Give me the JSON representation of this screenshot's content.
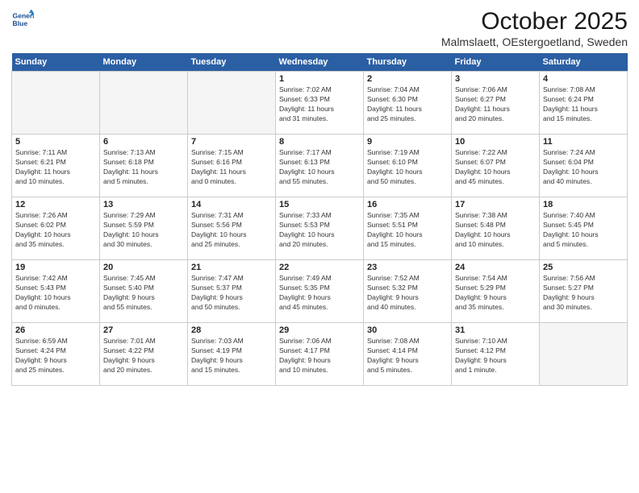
{
  "header": {
    "logo_line1": "General",
    "logo_line2": "Blue",
    "month": "October 2025",
    "location": "Malmslaett, OEstergoetland, Sweden"
  },
  "weekdays": [
    "Sunday",
    "Monday",
    "Tuesday",
    "Wednesday",
    "Thursday",
    "Friday",
    "Saturday"
  ],
  "weeks": [
    [
      {
        "day": "",
        "info": ""
      },
      {
        "day": "",
        "info": ""
      },
      {
        "day": "",
        "info": ""
      },
      {
        "day": "1",
        "info": "Sunrise: 7:02 AM\nSunset: 6:33 PM\nDaylight: 11 hours\nand 31 minutes."
      },
      {
        "day": "2",
        "info": "Sunrise: 7:04 AM\nSunset: 6:30 PM\nDaylight: 11 hours\nand 25 minutes."
      },
      {
        "day": "3",
        "info": "Sunrise: 7:06 AM\nSunset: 6:27 PM\nDaylight: 11 hours\nand 20 minutes."
      },
      {
        "day": "4",
        "info": "Sunrise: 7:08 AM\nSunset: 6:24 PM\nDaylight: 11 hours\nand 15 minutes."
      }
    ],
    [
      {
        "day": "5",
        "info": "Sunrise: 7:11 AM\nSunset: 6:21 PM\nDaylight: 11 hours\nand 10 minutes."
      },
      {
        "day": "6",
        "info": "Sunrise: 7:13 AM\nSunset: 6:18 PM\nDaylight: 11 hours\nand 5 minutes."
      },
      {
        "day": "7",
        "info": "Sunrise: 7:15 AM\nSunset: 6:16 PM\nDaylight: 11 hours\nand 0 minutes."
      },
      {
        "day": "8",
        "info": "Sunrise: 7:17 AM\nSunset: 6:13 PM\nDaylight: 10 hours\nand 55 minutes."
      },
      {
        "day": "9",
        "info": "Sunrise: 7:19 AM\nSunset: 6:10 PM\nDaylight: 10 hours\nand 50 minutes."
      },
      {
        "day": "10",
        "info": "Sunrise: 7:22 AM\nSunset: 6:07 PM\nDaylight: 10 hours\nand 45 minutes."
      },
      {
        "day": "11",
        "info": "Sunrise: 7:24 AM\nSunset: 6:04 PM\nDaylight: 10 hours\nand 40 minutes."
      }
    ],
    [
      {
        "day": "12",
        "info": "Sunrise: 7:26 AM\nSunset: 6:02 PM\nDaylight: 10 hours\nand 35 minutes."
      },
      {
        "day": "13",
        "info": "Sunrise: 7:29 AM\nSunset: 5:59 PM\nDaylight: 10 hours\nand 30 minutes."
      },
      {
        "day": "14",
        "info": "Sunrise: 7:31 AM\nSunset: 5:56 PM\nDaylight: 10 hours\nand 25 minutes."
      },
      {
        "day": "15",
        "info": "Sunrise: 7:33 AM\nSunset: 5:53 PM\nDaylight: 10 hours\nand 20 minutes."
      },
      {
        "day": "16",
        "info": "Sunrise: 7:35 AM\nSunset: 5:51 PM\nDaylight: 10 hours\nand 15 minutes."
      },
      {
        "day": "17",
        "info": "Sunrise: 7:38 AM\nSunset: 5:48 PM\nDaylight: 10 hours\nand 10 minutes."
      },
      {
        "day": "18",
        "info": "Sunrise: 7:40 AM\nSunset: 5:45 PM\nDaylight: 10 hours\nand 5 minutes."
      }
    ],
    [
      {
        "day": "19",
        "info": "Sunrise: 7:42 AM\nSunset: 5:43 PM\nDaylight: 10 hours\nand 0 minutes."
      },
      {
        "day": "20",
        "info": "Sunrise: 7:45 AM\nSunset: 5:40 PM\nDaylight: 9 hours\nand 55 minutes."
      },
      {
        "day": "21",
        "info": "Sunrise: 7:47 AM\nSunset: 5:37 PM\nDaylight: 9 hours\nand 50 minutes."
      },
      {
        "day": "22",
        "info": "Sunrise: 7:49 AM\nSunset: 5:35 PM\nDaylight: 9 hours\nand 45 minutes."
      },
      {
        "day": "23",
        "info": "Sunrise: 7:52 AM\nSunset: 5:32 PM\nDaylight: 9 hours\nand 40 minutes."
      },
      {
        "day": "24",
        "info": "Sunrise: 7:54 AM\nSunset: 5:29 PM\nDaylight: 9 hours\nand 35 minutes."
      },
      {
        "day": "25",
        "info": "Sunrise: 7:56 AM\nSunset: 5:27 PM\nDaylight: 9 hours\nand 30 minutes."
      }
    ],
    [
      {
        "day": "26",
        "info": "Sunrise: 6:59 AM\nSunset: 4:24 PM\nDaylight: 9 hours\nand 25 minutes."
      },
      {
        "day": "27",
        "info": "Sunrise: 7:01 AM\nSunset: 4:22 PM\nDaylight: 9 hours\nand 20 minutes."
      },
      {
        "day": "28",
        "info": "Sunrise: 7:03 AM\nSunset: 4:19 PM\nDaylight: 9 hours\nand 15 minutes."
      },
      {
        "day": "29",
        "info": "Sunrise: 7:06 AM\nSunset: 4:17 PM\nDaylight: 9 hours\nand 10 minutes."
      },
      {
        "day": "30",
        "info": "Sunrise: 7:08 AM\nSunset: 4:14 PM\nDaylight: 9 hours\nand 5 minutes."
      },
      {
        "day": "31",
        "info": "Sunrise: 7:10 AM\nSunset: 4:12 PM\nDaylight: 9 hours\nand 1 minute."
      },
      {
        "day": "",
        "info": ""
      }
    ]
  ]
}
